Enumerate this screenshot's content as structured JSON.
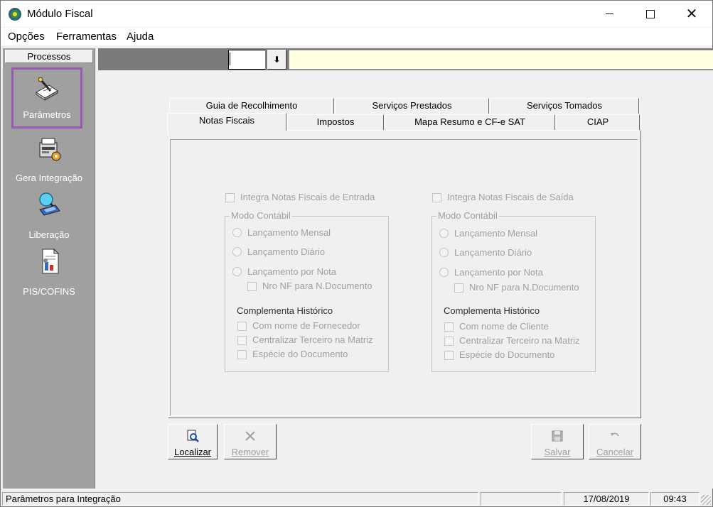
{
  "window": {
    "title": "Módulo Fiscal",
    "minimize": "—",
    "maximize": "☐",
    "close": "✕"
  },
  "menu": {
    "items": [
      "Opções",
      "Ferramentas",
      "Ajuda"
    ]
  },
  "sidebar": {
    "header": "Processos",
    "items": [
      {
        "label": "Parâmetros",
        "icon": "parameters-icon",
        "selected": true
      },
      {
        "label": "Gera Integração",
        "icon": "integration-icon",
        "selected": false
      },
      {
        "label": "Liberação",
        "icon": "release-icon",
        "selected": false
      },
      {
        "label": "PIS/COFINS",
        "icon": "piscofins-icon",
        "selected": false
      }
    ]
  },
  "toolbar": {
    "combo_value": "",
    "combo_button": "⬇",
    "description": ""
  },
  "tabs": {
    "row1": [
      "Guia de Recolhimento",
      "Serviços Prestados",
      "Serviços Tomados"
    ],
    "row2": [
      "Notas Fiscais",
      "Impostos",
      "Mapa Resumo e CF-e SAT",
      "CIAP"
    ],
    "active": "Notas Fiscais"
  },
  "entrada": {
    "integra_label": "Integra Notas Fiscais de Entrada",
    "modo_title": "Modo Contábil",
    "radios": [
      "Lançamento Mensal",
      "Lançamento Diário",
      "Lançamento por Nota"
    ],
    "nro_nf": "Nro NF para N.Documento",
    "complementa_title": "Complementa Histórico",
    "checks": [
      "Com nome de Fornecedor",
      "Centralizar Terceiro na Matriz",
      "Espécie do Documento"
    ]
  },
  "saida": {
    "integra_label": "Integra Notas Fiscais de Saída",
    "modo_title": "Modo Contábil",
    "radios": [
      "Lançamento Mensal",
      "Lançamento Diário",
      "Lançamento por Nota"
    ],
    "nro_nf": "Nro NF para N.Documento",
    "complementa_title": "Complementa Histórico",
    "checks": [
      "Com nome de Cliente",
      "Centralizar Terceiro na Matriz",
      "Espécie do Documento"
    ]
  },
  "actions": {
    "localizar": "Localizar",
    "remover": "Remover",
    "salvar": "Salvar",
    "cancelar": "Cancelar"
  },
  "status": {
    "message": "Parâmetros para Integração",
    "date": "17/08/2019",
    "time": "09:43"
  },
  "colors": {
    "sidebar_bg": "#a0a0a0",
    "selected_border": "#9b59b6",
    "description_bg": "#ffffe1",
    "strip_bg": "#7a7a7a"
  }
}
